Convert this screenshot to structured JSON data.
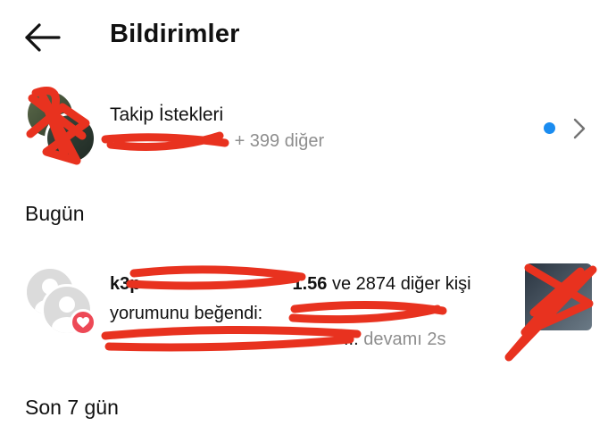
{
  "header": {
    "title": "Bildirimler",
    "back_icon": "arrow-left-icon"
  },
  "follow_requests": {
    "title": "Takip İstekleri",
    "subtitle_suffix": "+ 399 diğer",
    "unread_color": "#1a8cf0",
    "chevron_icon": "chevron-right-icon"
  },
  "sections": {
    "today": "Bugün",
    "last7": "Son 7 gün"
  },
  "notification": {
    "username_visible_start": "k3p",
    "username_visible_end": "1.56",
    "text_after_user": " ve 2874 diğer kişi",
    "line2": "yorumunu beğendi:",
    "ellipsis": "...",
    "more": "devamı",
    "time": "2s",
    "badge_icon": "heart-icon",
    "badge_color": "#ed4956"
  }
}
